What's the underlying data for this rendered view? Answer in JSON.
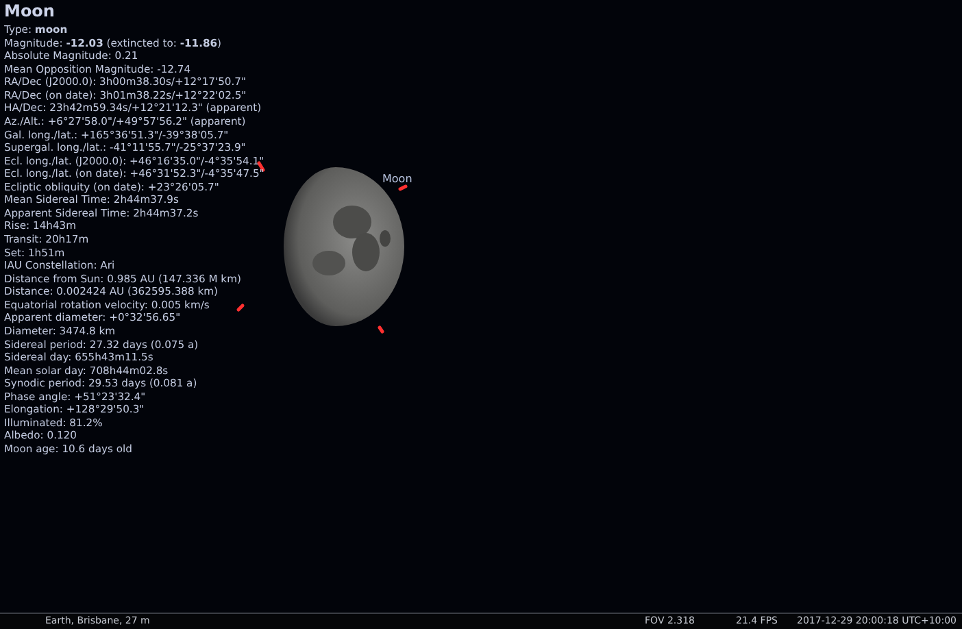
{
  "object": {
    "title": "Moon",
    "info_lines": [
      "Type: **moon**",
      "Magnitude: **-12.03** (extincted to: **-11.86**)",
      "Absolute Magnitude: 0.21",
      "Mean Opposition Magnitude: -12.74",
      "RA/Dec (J2000.0): 3h00m38.30s/+12°17'50.7\"",
      "RA/Dec (on date): 3h01m38.22s/+12°22'02.5\"",
      "HA/Dec: 23h42m59.34s/+12°21'12.3\" (apparent)",
      "Az./Alt.: +6°27'58.0\"/+49°57'56.2\" (apparent)",
      "Gal. long./lat.: +165°36'51.3\"/-39°38'05.7\"",
      "Supergal. long./lat.: -41°11'55.7\"/-25°37'23.9\"",
      "Ecl. long./lat. (J2000.0): +46°16'35.0\"/-4°35'54.1\"",
      "Ecl. long./lat. (on date): +46°31'52.3\"/-4°35'47.5\"",
      "Ecliptic obliquity (on date): +23°26'05.7\"",
      "Mean Sidereal Time: 2h44m37.9s",
      "Apparent Sidereal Time: 2h44m37.2s",
      "Rise: 14h43m",
      "Transit: 20h17m",
      "Set: 1h51m",
      "IAU Constellation: Ari",
      "Distance from Sun: 0.985 AU (147.336 M km)",
      "Distance: 0.002424 AU (362595.388 km)",
      "Equatorial rotation velocity: 0.005 km/s",
      "Apparent diameter: +0°32'56.65\"",
      "Diameter: 3474.8 km",
      "Sidereal period: 27.32 days (0.075 a)",
      "Sidereal day: 655h43m11.5s",
      "Mean solar day: 708h44m02.8s",
      "Synodic period: 29.53 days (0.081 a)",
      "Phase angle: +51°23'32.4\"",
      "Elongation: +128°29'50.3\"",
      "Illuminated: 81.2%",
      "Albedo: 0.120",
      "Moon age: 10.6 days old"
    ]
  },
  "sky_label": "Moon",
  "status_bar": {
    "location": "Earth, Brisbane, 27 m",
    "fov": "FOV 2.318",
    "fps": "21.4 FPS",
    "datetime": "2017-12-29 20:00:18 UTC+10:00"
  }
}
